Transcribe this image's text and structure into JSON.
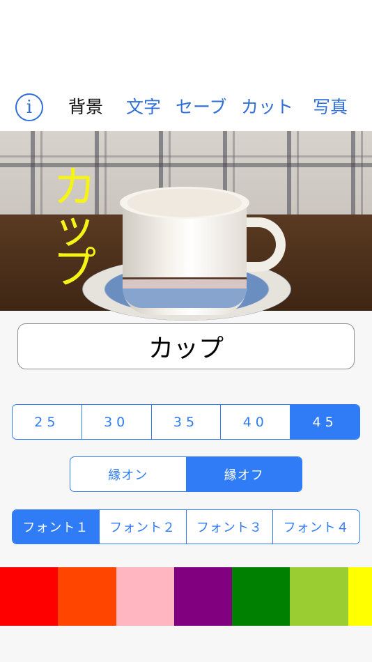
{
  "toolbar": {
    "info_icon": "info-circle-icon",
    "info_glyph": "i",
    "tabs": [
      {
        "label": "背景",
        "active": true
      },
      {
        "label": "文字",
        "active": false
      },
      {
        "label": "セーブ",
        "active": false
      },
      {
        "label": "カット",
        "active": false
      },
      {
        "label": "写真",
        "active": false
      }
    ]
  },
  "preview": {
    "overlay_text": "カップ",
    "overlay_color": "#f6f316"
  },
  "text_input": {
    "value": "カップ"
  },
  "size_selector": {
    "options": [
      "25",
      "30",
      "35",
      "40",
      "45"
    ],
    "selected": "45"
  },
  "edge_selector": {
    "options": [
      "縁オン",
      "縁オフ"
    ],
    "selected": "縁オフ"
  },
  "font_selector": {
    "options": [
      "フォント１",
      "フォント２",
      "フォント３",
      "フォント４"
    ],
    "selected": "フォント１"
  },
  "palette": {
    "colors": [
      "#ff0000",
      "#ff4500",
      "#ffb6c1",
      "#800080",
      "#008000",
      "#9acd32",
      "#ffff00"
    ]
  },
  "theme": {
    "accent": "#2f7cf6",
    "link": "#2f6fd6"
  }
}
